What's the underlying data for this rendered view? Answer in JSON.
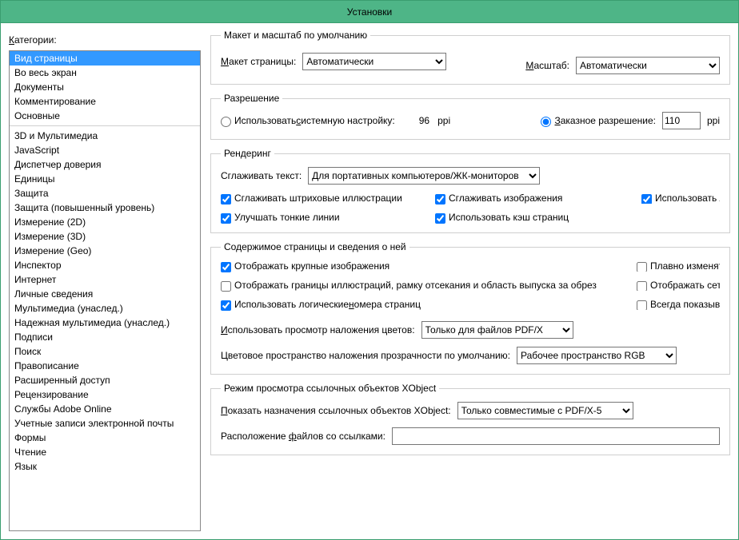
{
  "window": {
    "title": "Установки"
  },
  "left": {
    "label_pre": "К",
    "label_rest": "атегории:",
    "group1": [
      "Вид страницы",
      "Во весь экран",
      "Документы",
      "Комментирование",
      "Основные"
    ],
    "group2": [
      "3D и Мультимедиа",
      "JavaScript",
      "Диспетчер доверия",
      "Единицы",
      "Защита",
      "Защита (повышенный уровень)",
      "Измерение (2D)",
      "Измерение (3D)",
      "Измерение (Geo)",
      "Инспектор",
      "Интернет",
      "Личные сведения",
      "Мультимедиа (унаслед.)",
      "Надежная мультимедиа (унаслед.)",
      "Подписи",
      "Поиск",
      "Правописание",
      "Расширенный доступ",
      "Рецензирование",
      "Службы Adobe Online",
      "Учетные записи электронной почты",
      "Формы",
      "Чтение",
      "Язык"
    ],
    "selected": "Вид страницы"
  },
  "layout_zoom": {
    "legend": "Макет и масштаб по умолчанию",
    "page_layout_u": "М",
    "page_layout_rest": "акет страницы:",
    "page_layout_value": "Автоматически",
    "zoom_u": "М",
    "zoom_rest": "асштаб:",
    "zoom_value": "Автоматически"
  },
  "resolution": {
    "legend": "Разрешение",
    "system_pre": "Использовать ",
    "system_u": "с",
    "system_rest": "истемную настройку:",
    "system_ppi_value": "96",
    "ppi_unit": "ppi",
    "custom_pre": "",
    "custom_u": "З",
    "custom_rest": "аказное разрешение:",
    "custom_value": "110",
    "selected": "custom"
  },
  "rendering": {
    "legend": "Рендеринг",
    "smooth_text_label": "Сглаживать текст:",
    "smooth_text_value": "Для портативных компьютеров/ЖК-мониторов",
    "cb_smooth_lineart": "Сглаживать штриховые иллюстрации",
    "cb_smooth_images": "Сглаживать изображения",
    "cb_local_fonts": "Использовать локальные шрифты",
    "cb_enhance_thin": "Улучшать тонкие линии",
    "cb_page_cache": "Использовать кэш страниц",
    "v": {
      "smooth_lineart": true,
      "smooth_images": true,
      "local_fonts": true,
      "enhance_thin": true,
      "page_cache": true
    }
  },
  "page_content": {
    "legend": "Содержимое страницы и сведения о ней",
    "cb_large_images": "Отображать крупные изображения",
    "cb_smooth_zoom": "Плавно изменять масштаб",
    "cb_show_artbox": "Отображать границы иллюстраций, рамку отсекания и область выпуска за обрез",
    "cb_grid": "Отображать сетку прозрачности",
    "cb_logical_pages_pre": "Использовать логические ",
    "cb_logical_pages_u": "н",
    "cb_logical_pages_rest": "омера страниц",
    "cb_always_doc_size": "Всегда показывать размер документа",
    "overprint_label_u": "И",
    "overprint_label_rest": "спользовать просмотр наложения цветов:",
    "overprint_value": "Только для файлов PDF/X",
    "blendspace_label": "Цветовое пространство наложения прозрачности по умолчанию:",
    "blendspace_value": "Рабочее пространство RGB",
    "v": {
      "large_images": true,
      "smooth_zoom": false,
      "show_artbox": false,
      "grid": false,
      "logical_pages": true,
      "always_doc_size": false
    }
  },
  "xobject": {
    "legend": "Режим просмотра ссылочных объектов XObject",
    "show_targets_label_u": "П",
    "show_targets_label_rest": "оказать назначения ссылочных объектов XObject:",
    "show_targets_value": "Только совместимые с PDF/X-5",
    "files_label_pre": "Расположение ",
    "files_label_u": "ф",
    "files_label_rest": "айлов со ссылками:"
  }
}
